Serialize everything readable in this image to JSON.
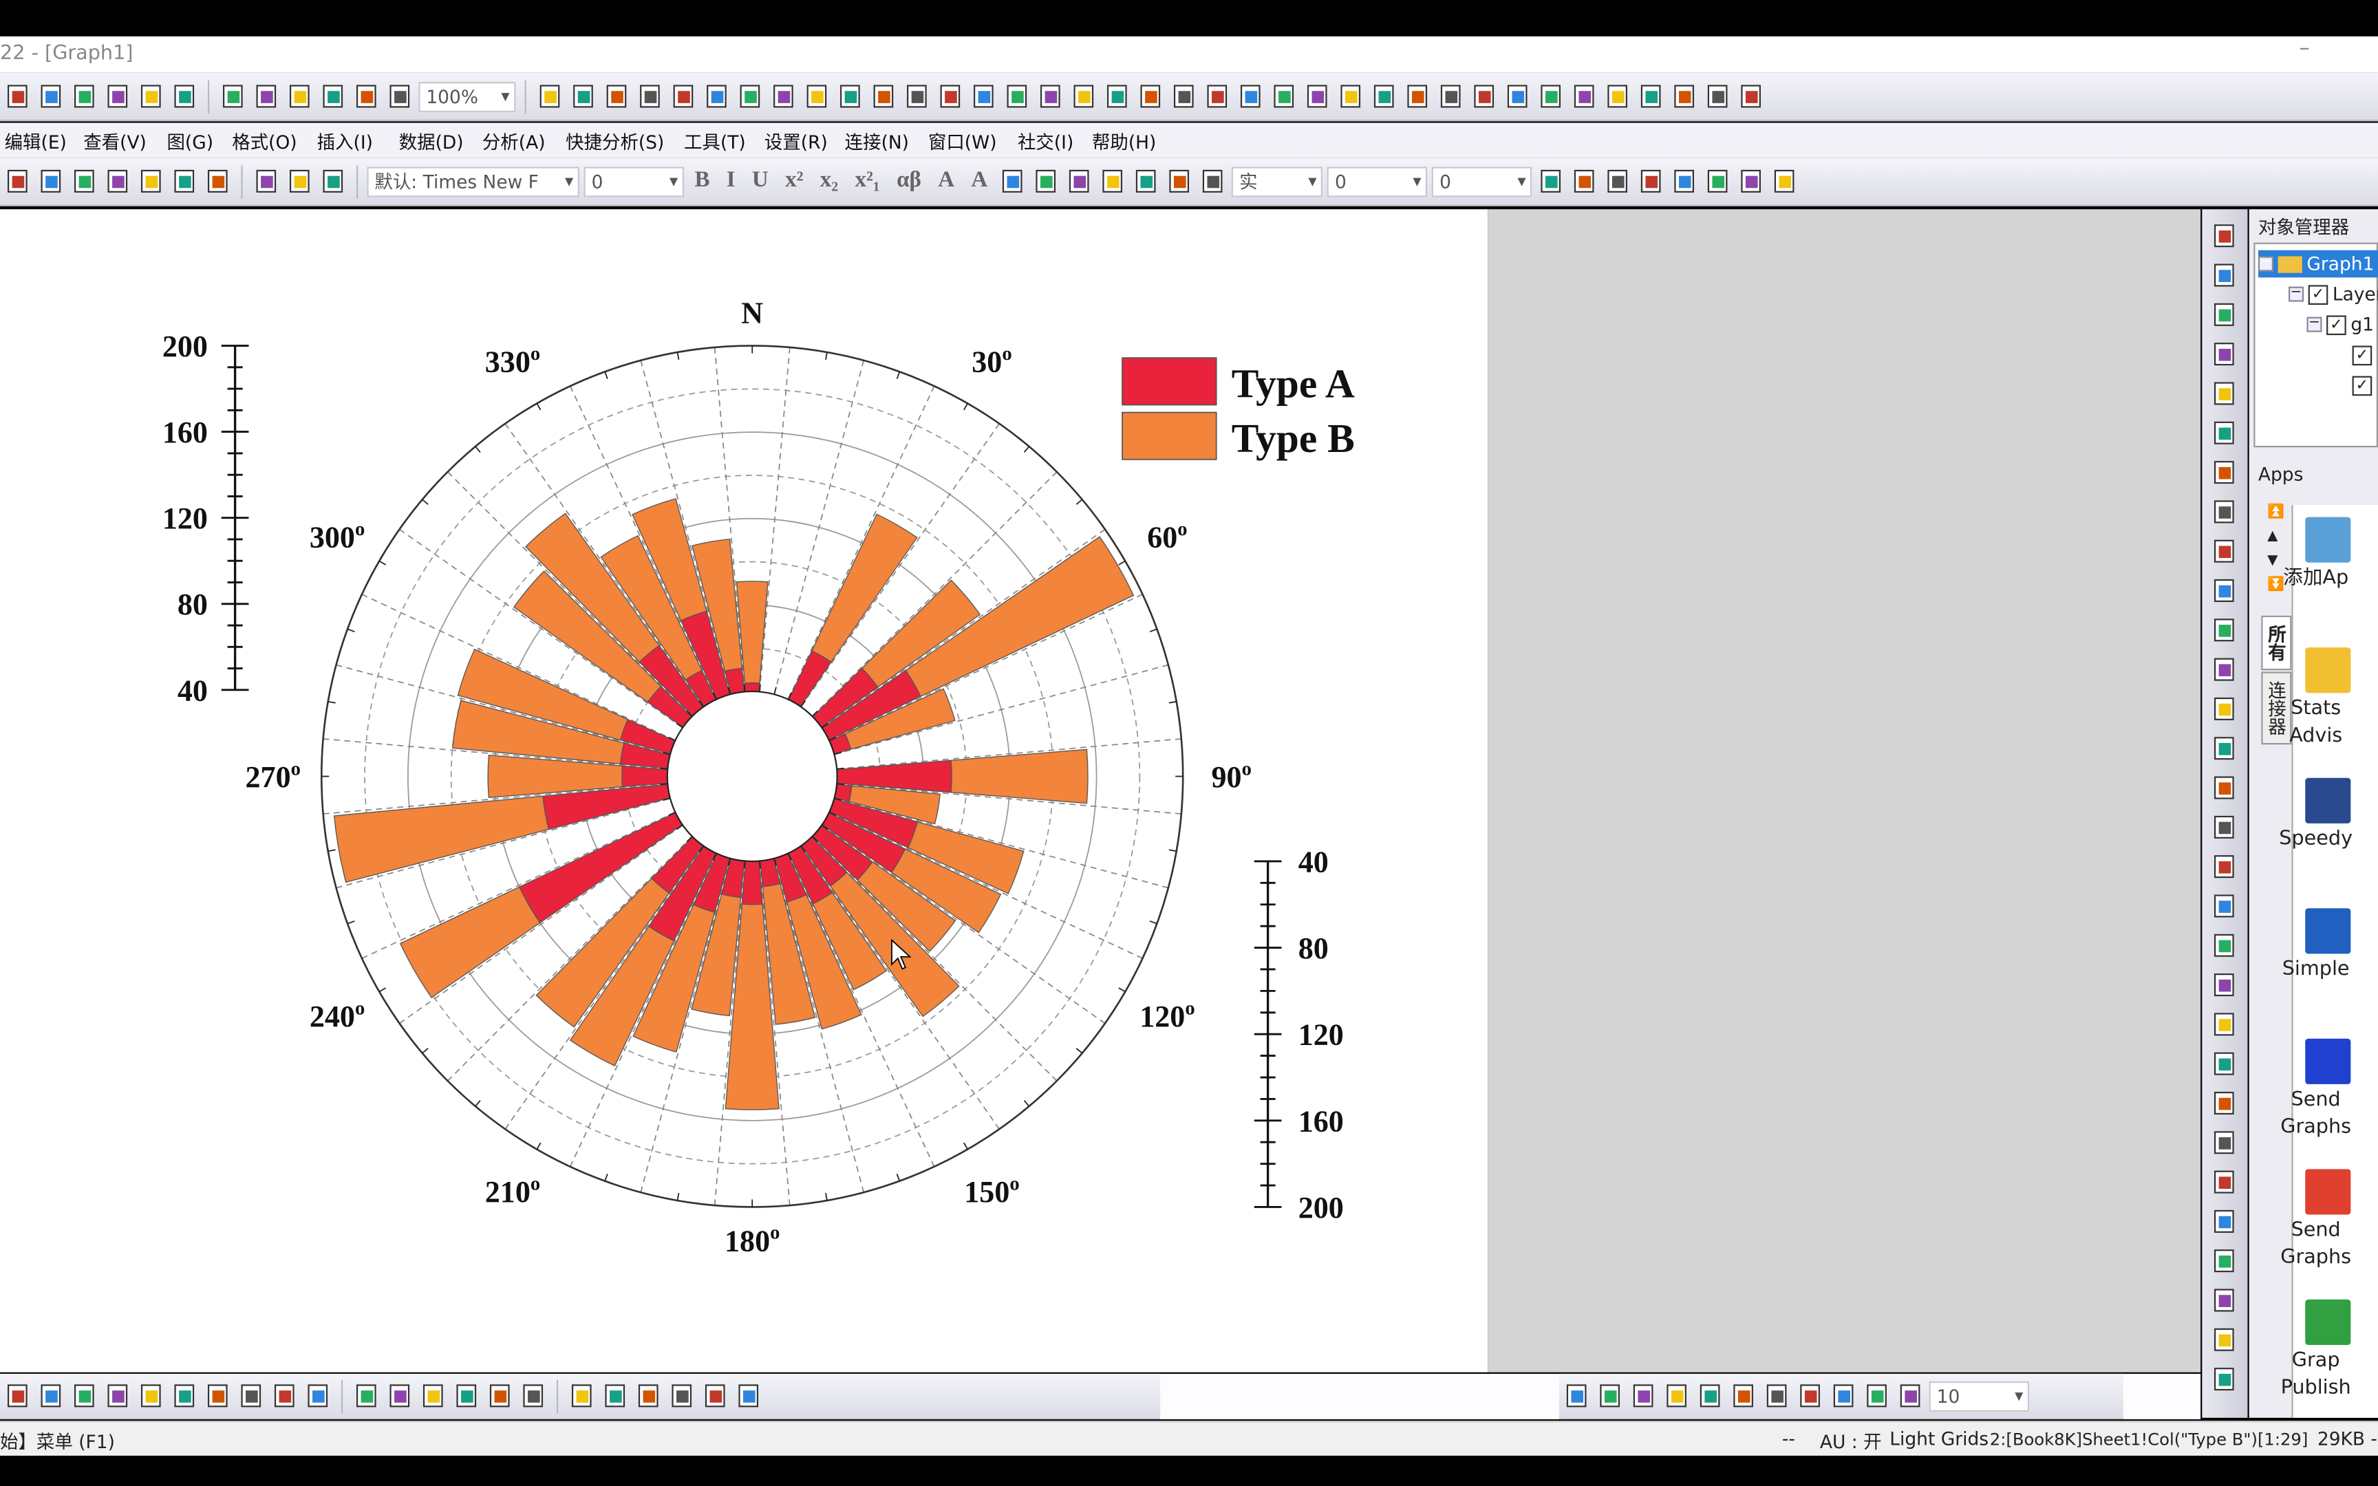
{
  "window": {
    "title": "22 - [Graph1]",
    "minimize": "–"
  },
  "toolbar1": {
    "icons_a": [
      "new-graph-icon",
      "new-workbook-icon",
      "line-plot-icon",
      "new-matrix-icon",
      "new-function-icon",
      "new-layout-icon"
    ],
    "icons_b": [
      "open-icon",
      "import-icon",
      "save-icon",
      "save-template-icon",
      "recalculate-icon",
      "disconnect-icon"
    ],
    "zoom": "100%",
    "icons_c": [
      "print-icon",
      "copy-page-icon",
      "image-icon",
      "columns-icon",
      "edit-icon",
      "rows-icon",
      "merge-icon",
      "hierarchy-icon",
      "zoom-in-icon",
      "data-reader-icon",
      "table-icon",
      "notes-icon",
      "plugin-icon",
      "add-column-icon",
      "sum-icon",
      "stats-icon",
      "sort-icon",
      "bar-icon",
      "column-chart-icon",
      "multi-column-icon",
      "split-icon",
      "filter-icon",
      "clear-filter-icon",
      "mark-icon",
      "x-icon",
      "y-icon",
      "z-icon",
      "error-icon",
      "none-icon",
      "first-icon",
      "prev-icon",
      "next-icon",
      "last-icon",
      "swap-icon",
      "down-icon",
      "right-arrow-icon",
      "right-arrow2-icon"
    ]
  },
  "menu": [
    "编辑(E)",
    "查看(V)",
    "图(G)",
    "格式(O)",
    "插入(I)",
    "数据(D)",
    "分析(A)",
    "快捷分析(S)",
    "工具(T)",
    "设置(R)",
    "连接(N)",
    "窗口(W)",
    "社交(I)",
    "帮助(H)"
  ],
  "toolbar2": {
    "icons_a": [
      "add-layer-icon",
      "merge-graph-icon",
      "extract-icon",
      "duplicate-icon",
      "add-plot-icon",
      "rescale-icon",
      "refresh-icon"
    ],
    "icons_b": [
      "cut-icon",
      "copy-icon",
      "paste-icon"
    ],
    "font": "默认: Times New F",
    "font_size": "0",
    "format_labels": [
      "B",
      "I",
      "U",
      "x²",
      "x₂",
      "x²₁",
      "αβ",
      "A",
      "A"
    ],
    "icons_c": [
      "align-icon",
      "columns-align-icon",
      "font-color-icon",
      "fill-color-icon",
      "pattern-color-icon",
      "line-color-icon",
      "brightness-icon"
    ],
    "line_style": "实",
    "line_width": "0",
    "pattern_value": "0",
    "icons_d": [
      "pattern-icon",
      "grid-icon",
      "table-format-icon",
      "m-icon",
      "delete-icon",
      "arrow-icon",
      "swap-arrow-icon",
      "export-icon"
    ]
  },
  "chart_data": {
    "type": "polar-stacked-bar",
    "radial_axis": {
      "range": [
        40,
        200
      ],
      "ticks": [
        "40",
        "80",
        "120",
        "160",
        "200"
      ]
    },
    "angular_axis": {
      "direction": "clockwise",
      "zero": "north",
      "bin_width_deg": 10,
      "labels": [
        "N",
        "30°",
        "60°",
        "90°",
        "120°",
        "150°",
        "180°",
        "210°",
        "240°",
        "270°",
        "300°",
        "330°"
      ]
    },
    "grid": true,
    "legend": {
      "placement": "top-right",
      "entries": [
        "Type A",
        "Type B"
      ]
    },
    "colors": {
      "Type A": "#E8233B",
      "Type B": "#F2843C"
    },
    "angles": [
      0,
      30,
      50,
      60,
      70,
      90,
      100,
      110,
      120,
      130,
      140,
      150,
      160,
      170,
      180,
      190,
      200,
      210,
      220,
      240,
      260,
      270,
      280,
      290,
      310,
      320,
      330,
      340,
      350
    ],
    "series": [
      {
        "name": "Type A",
        "values": [
          4,
          25,
          32,
          47,
          8,
          53,
          7,
          40,
          39,
          29,
          23,
          26,
          21,
          12,
          20,
          17,
          26,
          45,
          27,
          80,
          58,
          21,
          22,
          24,
          20,
          35,
          15,
          40,
          11
        ]
      },
      {
        "name": "Type B",
        "values": [
          47,
          70,
          58,
          109,
          50,
          63,
          41,
          51,
          49,
          47,
          74,
          44,
          61,
          64,
          95,
          55,
          67,
          64,
          76,
          61,
          97,
          62,
          78,
          78,
          76,
          75,
          69,
          54,
          60
        ]
      }
    ]
  },
  "object_manager": {
    "title": "对象管理器",
    "graph": "Graph1",
    "layer": "Layer",
    "group": "g1"
  },
  "apps": {
    "title": "Apps",
    "tabs": [
      "所有",
      "连接器"
    ],
    "items": [
      {
        "line1": "添加Ap",
        "line2": ""
      },
      {
        "line1": "Stats",
        "line2": "Advis"
      },
      {
        "line1": "Speedy",
        "line2": ""
      },
      {
        "line1": "Simple",
        "line2": ""
      },
      {
        "line1": "Send",
        "line2": "Graphs"
      },
      {
        "line1": "Send",
        "line2": "Graphs"
      },
      {
        "line1": "Grap",
        "line2": "Publish"
      }
    ]
  },
  "bottom_toolbar": {
    "icons_a": [
      "line-icon",
      "scatter-icon",
      "line-symbol-icon",
      "column-icon",
      "statistics-icon",
      "error-bar-icon",
      "area-icon",
      "polar-icon",
      "candlestick-icon",
      "template-icon"
    ],
    "icons_b": [
      "3d-icon",
      "surface-icon",
      "wire-icon",
      "contour-icon",
      "heatmap-icon",
      "ternary-icon"
    ],
    "icons_c": [
      "layout-a-icon",
      "layout-b-icon",
      "face-icon",
      "spacing-icon",
      "merge-v-icon",
      "split-v-icon"
    ],
    "icons_d": [
      "front-icon",
      "back-icon",
      "up-icon",
      "down-icon",
      "top-icon",
      "bottom-icon",
      "align-top-icon",
      "align-bottom-icon",
      "fit-icon",
      "pin-icon",
      "rotate-icon"
    ],
    "size_value": "10"
  },
  "status": {
    "left": "始】菜单 (F1)",
    "dash": "--",
    "au": "AU : 开",
    "grids": "Light Grids",
    "selection": "2:[Book8K]Sheet1!Col(\"Type B\")[1:29]",
    "size": "29KB -"
  }
}
